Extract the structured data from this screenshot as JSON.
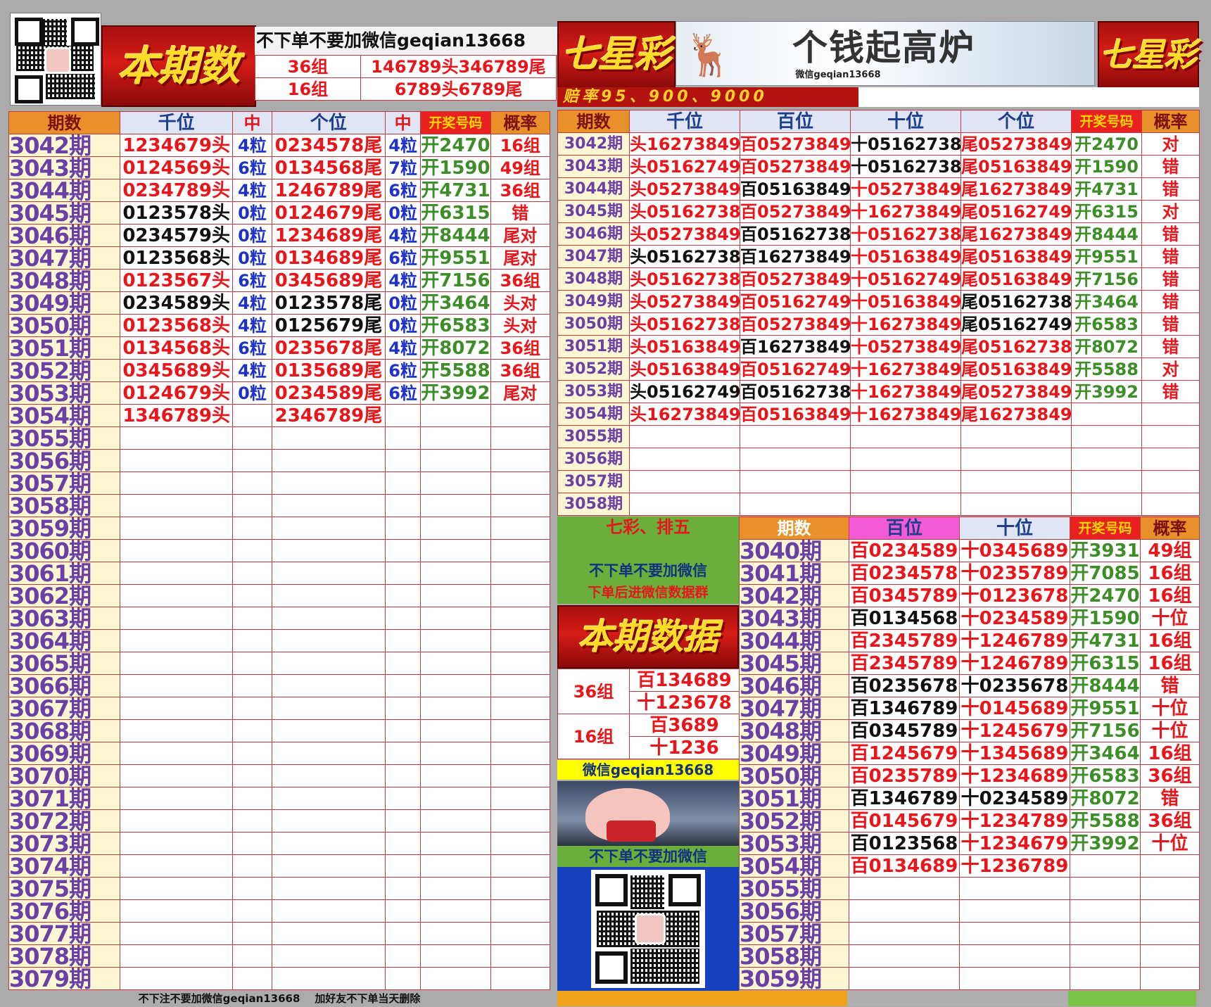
{
  "left": {
    "wechat_note": "不下单不要加微信geqian13668",
    "banner_text": "本期数据",
    "groups": [
      {
        "label": "36组",
        "value": "146789头346789尾"
      },
      {
        "label": "16组",
        "value": "6789头6789尾"
      }
    ],
    "headers": [
      "期数",
      "千位",
      "中",
      "个位",
      "中",
      "开奖号码",
      "概率"
    ],
    "rows": [
      [
        "3042期",
        "1234679头",
        "4粒",
        "0234578尾",
        "4粒",
        "开2470",
        "16组"
      ],
      [
        "3043期",
        "0124569头",
        "6粒",
        "0134568尾",
        "7粒",
        "开1590",
        "49组"
      ],
      [
        "3044期",
        "0234789头",
        "4粒",
        "1246789尾",
        "6粒",
        "开4731",
        "36组"
      ],
      [
        "3045期",
        "0123578头",
        "0粒",
        "0124679尾",
        "0粒",
        "开6315",
        "错"
      ],
      [
        "3046期",
        "0234579头",
        "0粒",
        "1234689尾",
        "4粒",
        "开8444",
        "尾对"
      ],
      [
        "3047期",
        "0123568头",
        "0粒",
        "0134689尾",
        "6粒",
        "开9551",
        "尾对"
      ],
      [
        "3048期",
        "0123567头",
        "6粒",
        "0345689尾",
        "4粒",
        "开7156",
        "36组"
      ],
      [
        "3049期",
        "0234589头",
        "4粒",
        "0123578尾",
        "0粒",
        "开3464",
        "头对"
      ],
      [
        "3050期",
        "0123568头",
        "4粒",
        "0125679尾",
        "0粒",
        "开6583",
        "头对"
      ],
      [
        "3051期",
        "0134568头",
        "6粒",
        "0235678尾",
        "4粒",
        "开8072",
        "36组"
      ],
      [
        "3052期",
        "0345689头",
        "4粒",
        "0135689尾",
        "6粒",
        "开5588",
        "36组"
      ],
      [
        "3053期",
        "0124679头",
        "0粒",
        "0234589尾",
        "6粒",
        "开3992",
        "尾对"
      ],
      [
        "3054期",
        "1346789头",
        "",
        "2346789尾",
        "",
        "",
        ""
      ],
      [
        "3055期",
        "",
        "",
        "",
        "",
        "",
        ""
      ],
      [
        "3056期",
        "",
        "",
        "",
        "",
        "",
        ""
      ],
      [
        "3057期",
        "",
        "",
        "",
        "",
        "",
        ""
      ],
      [
        "3058期",
        "",
        "",
        "",
        "",
        "",
        ""
      ],
      [
        "3059期",
        "",
        "",
        "",
        "",
        "",
        ""
      ],
      [
        "3060期",
        "",
        "",
        "",
        "",
        "",
        ""
      ],
      [
        "3061期",
        "",
        "",
        "",
        "",
        "",
        ""
      ],
      [
        "3062期",
        "",
        "",
        "",
        "",
        "",
        ""
      ],
      [
        "3063期",
        "",
        "",
        "",
        "",
        "",
        ""
      ],
      [
        "3064期",
        "",
        "",
        "",
        "",
        "",
        ""
      ],
      [
        "3065期",
        "",
        "",
        "",
        "",
        "",
        ""
      ],
      [
        "3066期",
        "",
        "",
        "",
        "",
        "",
        ""
      ],
      [
        "3067期",
        "",
        "",
        "",
        "",
        "",
        ""
      ],
      [
        "3068期",
        "",
        "",
        "",
        "",
        "",
        ""
      ],
      [
        "3069期",
        "",
        "",
        "",
        "",
        "",
        ""
      ],
      [
        "3070期",
        "",
        "",
        "",
        "",
        "",
        ""
      ],
      [
        "3071期",
        "",
        "",
        "",
        "",
        "",
        ""
      ],
      [
        "3072期",
        "",
        "",
        "",
        "",
        "",
        ""
      ],
      [
        "3073期",
        "",
        "",
        "",
        "",
        "",
        ""
      ],
      [
        "3074期",
        "",
        "",
        "",
        "",
        "",
        ""
      ],
      [
        "3075期",
        "",
        "",
        "",
        "",
        "",
        ""
      ],
      [
        "3076期",
        "",
        "",
        "",
        "",
        "",
        ""
      ],
      [
        "3077期",
        "",
        "",
        "",
        "",
        "",
        ""
      ],
      [
        "3078期",
        "",
        "",
        "",
        "",
        "",
        ""
      ],
      [
        "3079期",
        "",
        "",
        "",
        "",
        "",
        ""
      ]
    ],
    "footer": "不下注不要加微信geqian13668    加好友不下单当天删除"
  },
  "right": {
    "title_banner": "七星彩",
    "slogan_image": "个钱起高炉",
    "slogan_wechat": "微信geqian13668",
    "odds": "赔率95、900、9000",
    "headers": [
      "期数",
      "千位",
      "百位",
      "十位",
      "个位",
      "开奖号码",
      "概率"
    ],
    "rows": [
      [
        "3042期",
        "头16273849",
        "百05273849",
        "十05162738",
        "尾05273849",
        "开2470",
        "对"
      ],
      [
        "3043期",
        "头05162749",
        "百05273849",
        "十05162738",
        "尾05163849",
        "开1590",
        "错"
      ],
      [
        "3044期",
        "头05273849",
        "百05163849",
        "十05273849",
        "尾16273849",
        "开4731",
        "错"
      ],
      [
        "3045期",
        "头05162738",
        "百05273849",
        "十16273849",
        "尾05162749",
        "开6315",
        "对"
      ],
      [
        "3046期",
        "头05273849",
        "百05162738",
        "十05162738",
        "尾16273849",
        "开8444",
        "错"
      ],
      [
        "3047期",
        "头05162738",
        "百16273849",
        "十05163849",
        "尾05163849",
        "开9551",
        "错"
      ],
      [
        "3048期",
        "头05162738",
        "百05273849",
        "十05162749",
        "尾05163849",
        "开7156",
        "错"
      ],
      [
        "3049期",
        "头05273849",
        "百05162749",
        "十05163849",
        "尾05162738",
        "开3464",
        "错"
      ],
      [
        "3050期",
        "头05162738",
        "百05273849",
        "十16273849",
        "尾05162749",
        "开6583",
        "错"
      ],
      [
        "3051期",
        "头05163849",
        "百16273849",
        "十05273849",
        "尾05162738",
        "开8072",
        "错"
      ],
      [
        "3052期",
        "头05163849",
        "百05162749",
        "十16273849",
        "尾05163849",
        "开5588",
        "对"
      ],
      [
        "3053期",
        "头05162749",
        "百05162738",
        "十16273849",
        "尾05273849",
        "开3992",
        "错"
      ],
      [
        "3054期",
        "头16273849",
        "百05163849",
        "十16273849",
        "尾16273849",
        "",
        ""
      ],
      [
        "3055期",
        "",
        "",
        "",
        "",
        "",
        ""
      ],
      [
        "3056期",
        "",
        "",
        "",
        "",
        "",
        ""
      ],
      [
        "3057期",
        "",
        "",
        "",
        "",
        "",
        ""
      ],
      [
        "3058期",
        "",
        "",
        "",
        "",
        "",
        ""
      ]
    ],
    "side": {
      "title": "七彩、排五",
      "note1": "不下单不要加微信",
      "note2": "下单后进微信数据群",
      "banner_text": "本期数据",
      "g36": "36组",
      "g36_bai": "百134689",
      "g36_shi": "十123678",
      "g16": "16组",
      "g16_bai": "百3689",
      "g16_shi": "十1236",
      "wechat": "微信geqian13668",
      "note3": "不下单不要加微信"
    },
    "bottom_headers": [
      "期数",
      "百位",
      "十位",
      "开奖号码",
      "概率"
    ],
    "bottom_rows": [
      [
        "3040期",
        "百0234589",
        "十0345689",
        "开3931",
        "49组"
      ],
      [
        "3041期",
        "百0234578",
        "十0235789",
        "开7085",
        "16组"
      ],
      [
        "3042期",
        "百0345789",
        "十0123678",
        "开2470",
        "16组"
      ],
      [
        "3043期",
        "百0134568",
        "十0234589",
        "开1590",
        "十位"
      ],
      [
        "3044期",
        "百2345789",
        "十1246789",
        "开4731",
        "16组"
      ],
      [
        "3045期",
        "百2345789",
        "十1246789",
        "开6315",
        "16组"
      ],
      [
        "3046期",
        "百0235678",
        "十0235678",
        "开8444",
        "错"
      ],
      [
        "3047期",
        "百1346789",
        "十0145689",
        "开9551",
        "十位"
      ],
      [
        "3048期",
        "百0345789",
        "十1245679",
        "开7156",
        "十位"
      ],
      [
        "3049期",
        "百1245679",
        "十1345689",
        "开3464",
        "16组"
      ],
      [
        "3050期",
        "百0235789",
        "十1234689",
        "开6583",
        "36组"
      ],
      [
        "3051期",
        "百1346789",
        "十0234589",
        "开8072",
        "错"
      ],
      [
        "3052期",
        "百0145679",
        "十1234789",
        "开5588",
        "36组"
      ],
      [
        "3053期",
        "百0123568",
        "十1234679",
        "开3992",
        "十位"
      ],
      [
        "3054期",
        "百0134689",
        "十1236789",
        "",
        ""
      ],
      [
        "3055期",
        "",
        "",
        "",
        ""
      ],
      [
        "3056期",
        "",
        "",
        "",
        ""
      ],
      [
        "3057期",
        "",
        "",
        "",
        ""
      ],
      [
        "3058期",
        "",
        "",
        "",
        ""
      ],
      [
        "3059期",
        "",
        "",
        "",
        ""
      ]
    ]
  },
  "colors": {
    "red": "#e8161b",
    "black": "#111111",
    "blue": "#1d33c8",
    "green": "#3d8d28",
    "purple": "#6a3fa6",
    "period_bg": "#fdf6d3",
    "header_orange": "#e8912a"
  }
}
